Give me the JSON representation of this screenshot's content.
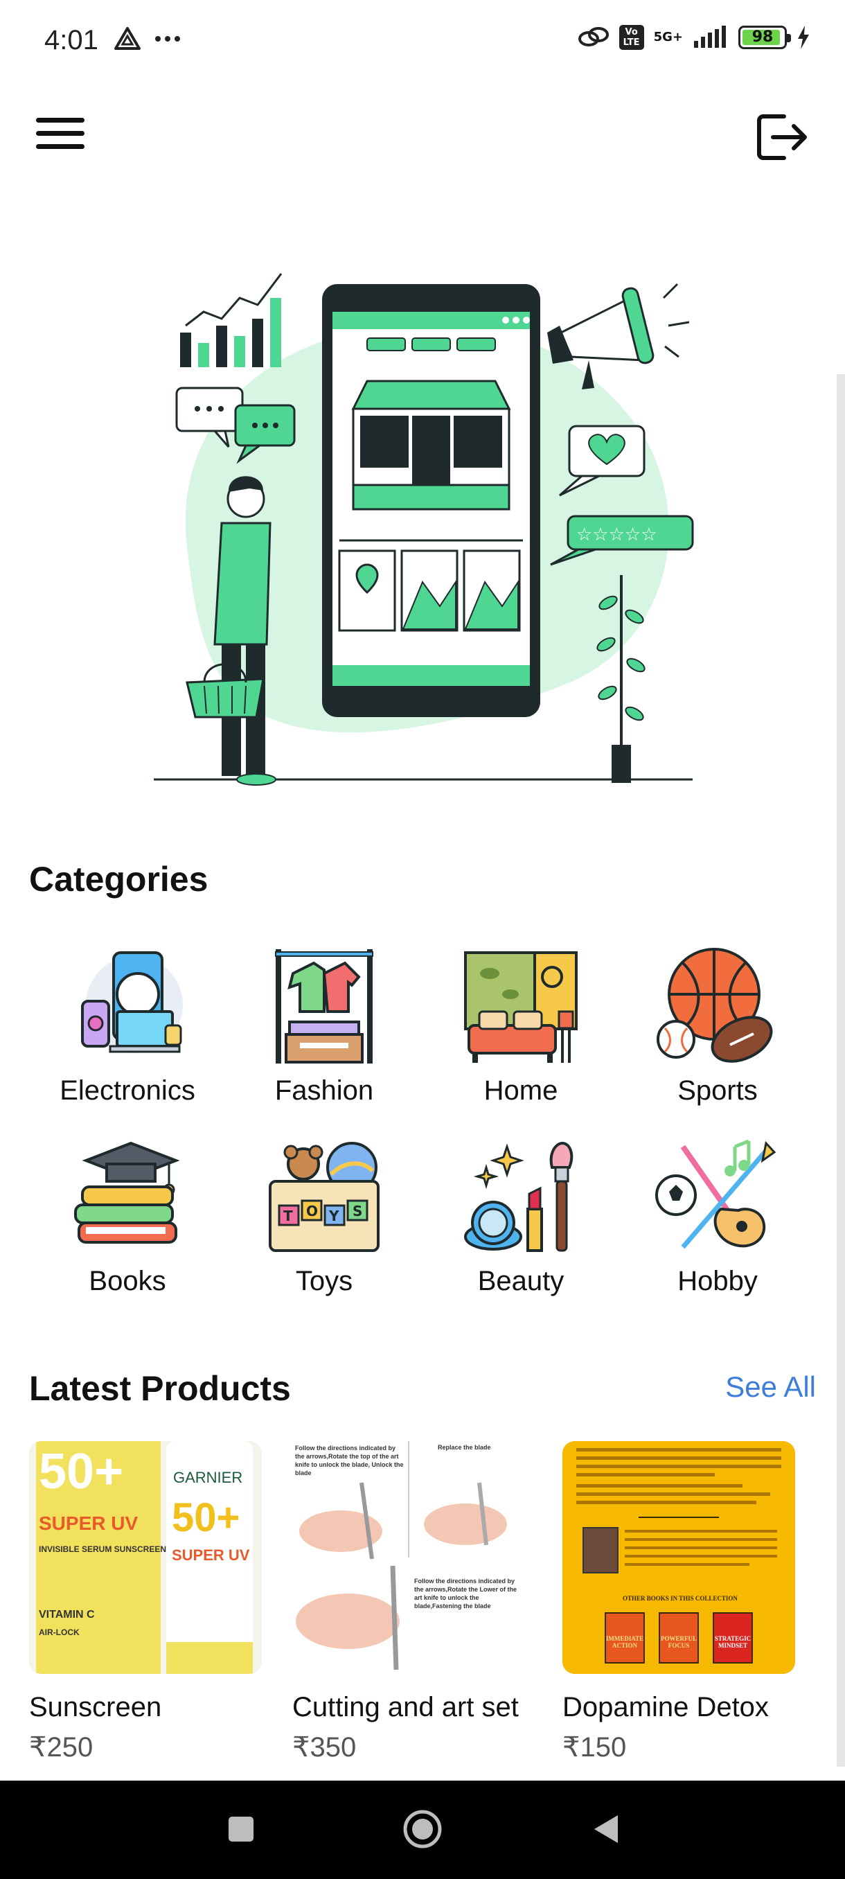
{
  "status": {
    "time": "4:01",
    "network_top": "5G+",
    "volte_label": "Vo LTE",
    "battery": "98"
  },
  "header": {
    "menu_icon": "hamburger-menu-icon",
    "logout_icon": "logout-icon"
  },
  "categories": {
    "title": "Categories",
    "items": [
      {
        "label": "Electronics",
        "icon": "electronics-icon"
      },
      {
        "label": "Fashion",
        "icon": "fashion-icon"
      },
      {
        "label": "Home",
        "icon": "home-icon"
      },
      {
        "label": "Sports",
        "icon": "sports-icon"
      },
      {
        "label": "Books",
        "icon": "books-icon"
      },
      {
        "label": "Toys",
        "icon": "toys-icon"
      },
      {
        "label": "Beauty",
        "icon": "beauty-icon"
      },
      {
        "label": "Hobby",
        "icon": "hobby-icon"
      }
    ]
  },
  "latest": {
    "title": "Latest Products",
    "see_all": "See All",
    "products": [
      {
        "name": "Sunscreen",
        "price": "₹250",
        "image_text": [
          "50+",
          "SUPER UV",
          "GARNIER",
          "INVISIBLE SERUM SUNSCREEN",
          "VITAMIN C",
          "AIR-LOCK"
        ]
      },
      {
        "name": "Cutting and art set",
        "price": "₹350",
        "image_text": [
          "Follow the directions indicated by the arrows,Rotate the top of the art knife to unlock the blade, Unlock the blade",
          "Replace the blade",
          "Follow the directions indicated by the arrows,Rotate the Lower of the art knife to unlock the blade,Fastening the blade"
        ]
      },
      {
        "name": "Dopamine Detox",
        "price": "₹150",
        "image_text": [
          "OTHER BOOKS IN THIS COLLECTION",
          "IMMEDIATE ACTION",
          "POWERFUL FOCUS",
          "STRATEGIC MINDSET"
        ]
      }
    ]
  },
  "colors": {
    "accent_green": "#4fd693",
    "light_green": "#d6f5e3",
    "dark": "#1e2a2c",
    "link_blue": "#3d7ddb",
    "book_yellow": "#f7b800"
  }
}
